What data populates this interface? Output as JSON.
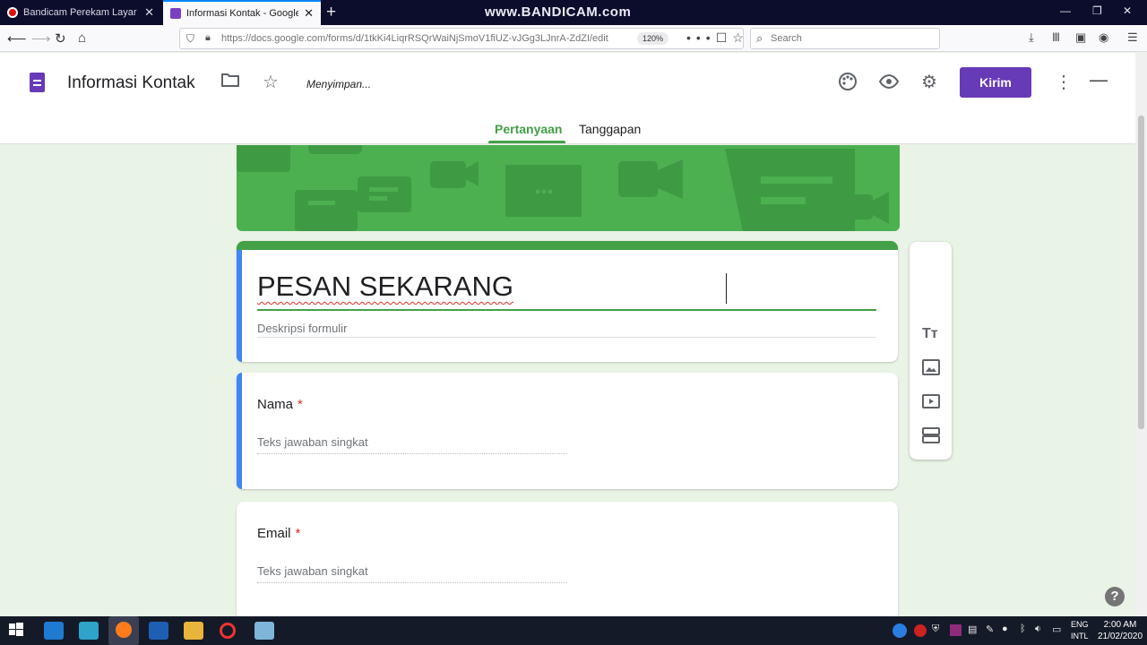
{
  "browser": {
    "tabs": [
      {
        "title": "Bandicam Perekam Layar - Apl",
        "active": false
      },
      {
        "title": "Informasi Kontak - Google Forms",
        "active": true
      }
    ],
    "new_tab": "+",
    "watermark": "www.BANDICAM.com",
    "url": "https://docs.google.com/forms/d/1tkKi4LiqrRSQrWaiNjSmoV1fiUZ-vJGg3LJnrA-ZdZI/edit",
    "zoom": "120%",
    "search_placeholder": "Search"
  },
  "form_header": {
    "title": "Informasi Kontak",
    "status": "Menyimpan...",
    "send_label": "Kirim",
    "tabs": [
      {
        "label": "Pertanyaan",
        "active": true
      },
      {
        "label": "Tanggapan",
        "active": false
      }
    ]
  },
  "form": {
    "title": "PESAN SEKARANG",
    "description_placeholder": "Deskripsi formulir",
    "questions": [
      {
        "label": "Nama",
        "required": "*",
        "answer_placeholder": "Teks jawaban singkat"
      },
      {
        "label": "Email",
        "required": "*",
        "answer_placeholder": "Teks jawaban singkat"
      }
    ]
  },
  "taskbar": {
    "lang": [
      "ENG",
      "INTL"
    ],
    "time": "2:00 AM",
    "date": "21/02/2020"
  },
  "colors": {
    "accent_purple": "#673ab7",
    "theme_green": "#43a047",
    "banner_green": "#4caf50",
    "focus_blue": "#4285f4",
    "required_red": "#d93025"
  },
  "icons": [
    "folder-icon",
    "star-icon",
    "palette-icon",
    "eye-icon",
    "gear-icon",
    "more-vert-icon",
    "title-text-icon",
    "image-icon",
    "video-icon",
    "section-icon",
    "help-icon"
  ]
}
